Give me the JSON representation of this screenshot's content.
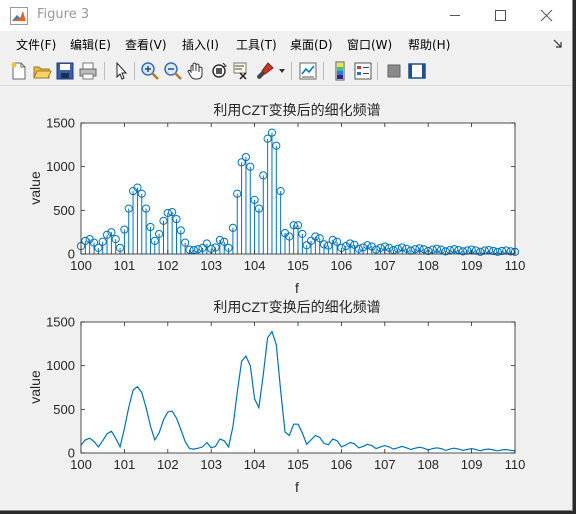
{
  "window": {
    "title": "Figure 3"
  },
  "menu": [
    "文件(F)",
    "编辑(E)",
    "查看(V)",
    "插入(I)",
    "工具(T)",
    "桌面(D)",
    "窗口(W)",
    "帮助(H)"
  ],
  "toolbar_icons": [
    "new-figure-icon",
    "open-file-icon",
    "save-icon",
    "print-icon",
    "pointer-icon",
    "zoom-in-icon",
    "zoom-out-icon",
    "pan-icon",
    "rotate-3d-icon",
    "data-cursor-icon",
    "brush-icon",
    "link-plot-icon",
    "colorbar-icon",
    "legend-icon",
    "hide-plot-tools-icon",
    "show-plot-tools-icon"
  ],
  "colors": {
    "series": "#0072bd",
    "axes_bg": "#ffffff",
    "figure_bg": "#f0f0f0"
  },
  "chart_data": [
    {
      "type": "stem",
      "title": "利用CZT变换后的细化频谱",
      "xlabel": "f",
      "ylabel": "value",
      "xlim": [
        100,
        110
      ],
      "ylim": [
        0,
        1500
      ],
      "xticks": [
        "100",
        "101",
        "102",
        "103",
        "104",
        "105",
        "106",
        "107",
        "108",
        "109",
        "110"
      ],
      "yticks": [
        "0",
        "500",
        "1000",
        "1500"
      ],
      "x": [
        100.0,
        100.1,
        100.2,
        100.3,
        100.4,
        100.5,
        100.6,
        100.7,
        100.8,
        100.9,
        101.0,
        101.1,
        101.2,
        101.3,
        101.4,
        101.5,
        101.6,
        101.7,
        101.8,
        101.9,
        102.0,
        102.1,
        102.2,
        102.3,
        102.4,
        102.5,
        102.6,
        102.7,
        102.8,
        102.9,
        103.0,
        103.1,
        103.2,
        103.3,
        103.4,
        103.5,
        103.6,
        103.7,
        103.8,
        103.9,
        104.0,
        104.1,
        104.2,
        104.3,
        104.4,
        104.5,
        104.6,
        104.7,
        104.8,
        104.9,
        105.0,
        105.1,
        105.2,
        105.3,
        105.4,
        105.5,
        105.6,
        105.7,
        105.8,
        105.9,
        106.0,
        106.1,
        106.2,
        106.3,
        106.4,
        106.5,
        106.6,
        106.7,
        106.8,
        106.9,
        107.0,
        107.1,
        107.2,
        107.3,
        107.4,
        107.5,
        107.6,
        107.7,
        107.8,
        107.9,
        108.0,
        108.1,
        108.2,
        108.3,
        108.4,
        108.5,
        108.6,
        108.7,
        108.8,
        108.9,
        109.0,
        109.1,
        109.2,
        109.3,
        109.4,
        109.5,
        109.6,
        109.7,
        109.8,
        109.9,
        110.0
      ],
      "y": [
        90,
        150,
        170,
        130,
        70,
        140,
        220,
        250,
        170,
        70,
        280,
        520,
        720,
        760,
        690,
        520,
        310,
        150,
        230,
        380,
        470,
        480,
        400,
        270,
        130,
        50,
        45,
        55,
        70,
        120,
        60,
        75,
        160,
        140,
        70,
        300,
        690,
        1050,
        1110,
        1000,
        620,
        520,
        900,
        1320,
        1390,
        1240,
        720,
        240,
        200,
        330,
        330,
        230,
        100,
        150,
        200,
        180,
        110,
        95,
        160,
        140,
        70,
        90,
        120,
        105,
        60,
        75,
        100,
        85,
        50,
        70,
        85,
        70,
        45,
        60,
        75,
        60,
        40,
        55,
        65,
        55,
        35,
        50,
        60,
        50,
        30,
        45,
        55,
        45,
        30,
        40,
        50,
        40,
        25,
        40,
        45,
        35,
        25,
        35,
        40,
        30,
        25
      ]
    },
    {
      "type": "line",
      "title": "利用CZT变换后的细化频谱",
      "xlabel": "f",
      "ylabel": "value",
      "xlim": [
        100,
        110
      ],
      "ylim": [
        0,
        1500
      ],
      "xticks": [
        "100",
        "101",
        "102",
        "103",
        "104",
        "105",
        "106",
        "107",
        "108",
        "109",
        "110"
      ],
      "yticks": [
        "0",
        "500",
        "1000",
        "1500"
      ],
      "x": [
        100.0,
        100.1,
        100.2,
        100.3,
        100.4,
        100.5,
        100.6,
        100.7,
        100.8,
        100.9,
        101.0,
        101.1,
        101.2,
        101.3,
        101.4,
        101.5,
        101.6,
        101.7,
        101.8,
        101.9,
        102.0,
        102.1,
        102.2,
        102.3,
        102.4,
        102.5,
        102.6,
        102.7,
        102.8,
        102.9,
        103.0,
        103.1,
        103.2,
        103.3,
        103.4,
        103.5,
        103.6,
        103.7,
        103.8,
        103.9,
        104.0,
        104.1,
        104.2,
        104.3,
        104.4,
        104.5,
        104.6,
        104.7,
        104.8,
        104.9,
        105.0,
        105.1,
        105.2,
        105.3,
        105.4,
        105.5,
        105.6,
        105.7,
        105.8,
        105.9,
        106.0,
        106.1,
        106.2,
        106.3,
        106.4,
        106.5,
        106.6,
        106.7,
        106.8,
        106.9,
        107.0,
        107.1,
        107.2,
        107.3,
        107.4,
        107.5,
        107.6,
        107.7,
        107.8,
        107.9,
        108.0,
        108.1,
        108.2,
        108.3,
        108.4,
        108.5,
        108.6,
        108.7,
        108.8,
        108.9,
        109.0,
        109.1,
        109.2,
        109.3,
        109.4,
        109.5,
        109.6,
        109.7,
        109.8,
        109.9,
        110.0
      ],
      "y": [
        90,
        150,
        170,
        130,
        70,
        140,
        220,
        250,
        170,
        70,
        280,
        520,
        720,
        760,
        690,
        520,
        310,
        150,
        230,
        380,
        470,
        480,
        400,
        270,
        130,
        50,
        45,
        55,
        70,
        120,
        60,
        75,
        160,
        140,
        70,
        300,
        690,
        1050,
        1110,
        1000,
        620,
        520,
        900,
        1320,
        1390,
        1240,
        720,
        240,
        200,
        330,
        330,
        230,
        100,
        150,
        200,
        180,
        110,
        95,
        160,
        140,
        70,
        90,
        120,
        105,
        60,
        75,
        100,
        85,
        50,
        70,
        85,
        70,
        45,
        60,
        75,
        60,
        40,
        55,
        65,
        55,
        35,
        50,
        60,
        50,
        30,
        45,
        55,
        45,
        30,
        40,
        50,
        40,
        25,
        40,
        45,
        35,
        25,
        35,
        40,
        30,
        25
      ]
    }
  ]
}
